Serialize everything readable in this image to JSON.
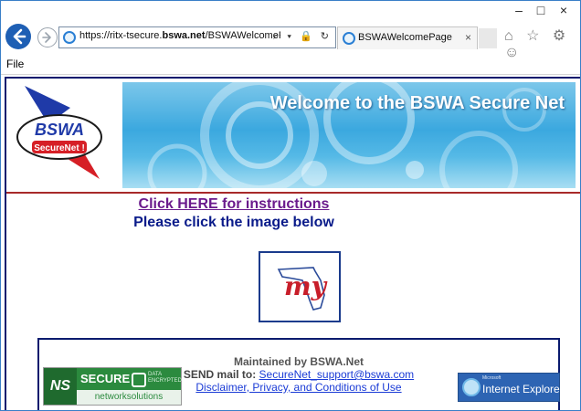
{
  "browser": {
    "url_prefix": "https://ritx-tsecure.",
    "url_domain": "bswa.net",
    "url_path": "/BSWAWelcomeFlɔ",
    "address_controls": "⌕ ▾ 🔒 ↻",
    "tab_title": "BSWAWelcomePage",
    "tab_close": "×",
    "win_minimize": "–",
    "win_maximize": "□",
    "win_close": "×",
    "back_arrow": "←",
    "forward_arrow": "→",
    "tools_icons": "⌂ ☆ ⚙ ☺"
  },
  "menu": {
    "file": "File"
  },
  "banner": {
    "title": "Welcome to the BSWA Secure Net",
    "logo_text_top": "BSWA",
    "logo_text_bottom": "SecureNet !"
  },
  "main": {
    "instructions_link": "Click HERE for instructions",
    "prompt": "Please click the image below",
    "image_text": "my"
  },
  "footer": {
    "maintained": "Maintained by BSWA.Net",
    "send_label": "SEND mail to:",
    "send_email": "SecureNet_support@bswa.com",
    "disclaimer_link": "Disclaimer, Privacy, and Conditions of Use",
    "ns_logo": "NS",
    "ns_secure": "SECURE",
    "ns_encrypted_1": "DATA",
    "ns_encrypted_2": "ENCRYPTED",
    "ns_bottom": "networksolutions",
    "ie_ms": "Microsoft",
    "ie_label": "Internet Explorer"
  }
}
